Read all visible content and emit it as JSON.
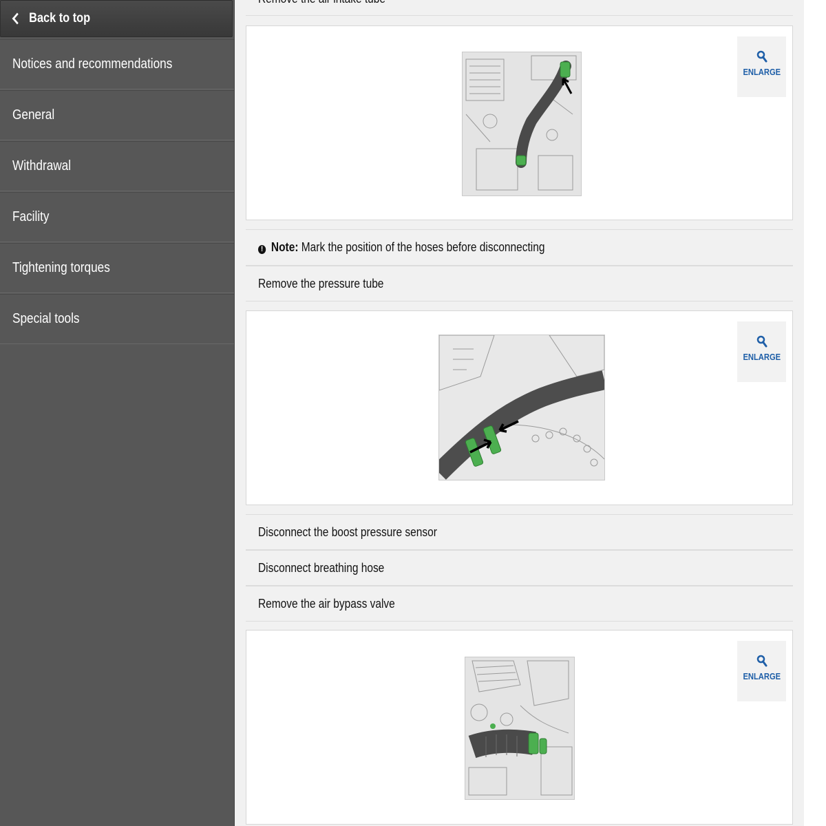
{
  "sidebar": {
    "back_label": "Back to top",
    "items": [
      {
        "label": "Notices and recommendations"
      },
      {
        "label": "General"
      },
      {
        "label": "Withdrawal"
      },
      {
        "label": "Facility"
      },
      {
        "label": "Tightening torques"
      },
      {
        "label": "Special tools"
      }
    ]
  },
  "content": {
    "top_step": "Remove the air intake tube",
    "note_label": "Note:",
    "note_text": "Mark the position of the hoses before disconnecting",
    "step_pressure_tube": "Remove the pressure tube",
    "step_boost_sensor": "Disconnect the boost pressure sensor",
    "step_breathing_hose": "Disconnect breathing hose",
    "step_bypass_valve": "Remove the air bypass valve",
    "enlarge_label": "ENLARGE"
  },
  "colors": {
    "sidebar_bg": "#575757",
    "accent_blue": "#1f5fa8",
    "highlight_green": "#4caf50"
  }
}
